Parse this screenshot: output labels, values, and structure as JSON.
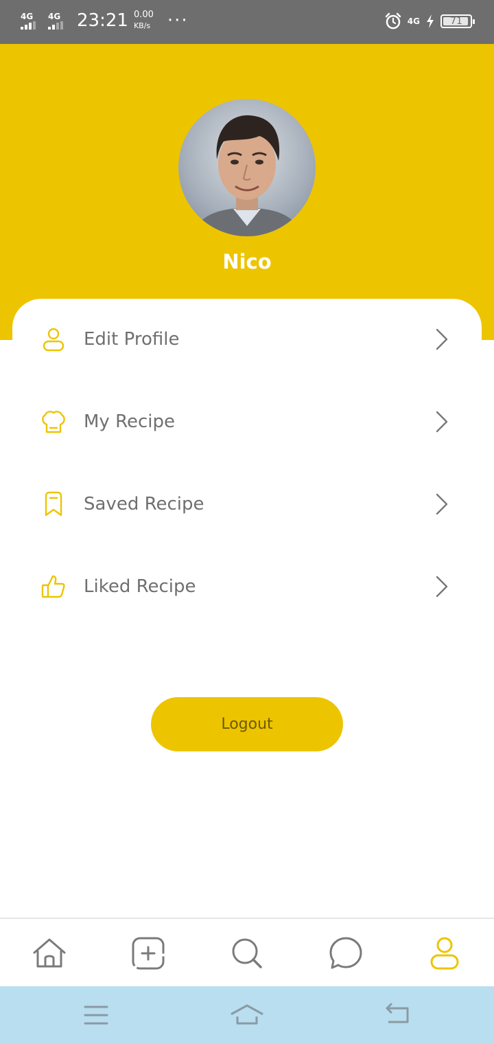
{
  "status_bar": {
    "sim1": "4G",
    "sim2": "4G",
    "time": "23:21",
    "speed_value": "0.00",
    "speed_unit": "KB/s",
    "more": "···",
    "network": "4G",
    "battery": "71"
  },
  "profile": {
    "name": "Nico"
  },
  "menu": {
    "items": [
      {
        "label": "Edit Profile",
        "icon": "person-icon"
      },
      {
        "label": "My Recipe",
        "icon": "chef-hat-icon"
      },
      {
        "label": "Saved Recipe",
        "icon": "bookmark-icon"
      },
      {
        "label": "Liked Recipe",
        "icon": "thumbs-up-icon"
      }
    ]
  },
  "logout_label": "Logout",
  "bottom_nav": {
    "items": [
      "home-icon",
      "add-icon",
      "search-icon",
      "chat-icon",
      "profile-icon"
    ],
    "active": "profile-icon"
  },
  "colors": {
    "accent": "#edc400",
    "text_muted": "#6f6f6f",
    "system_nav": "#b8def0",
    "status_bar": "#6e6e6e"
  }
}
